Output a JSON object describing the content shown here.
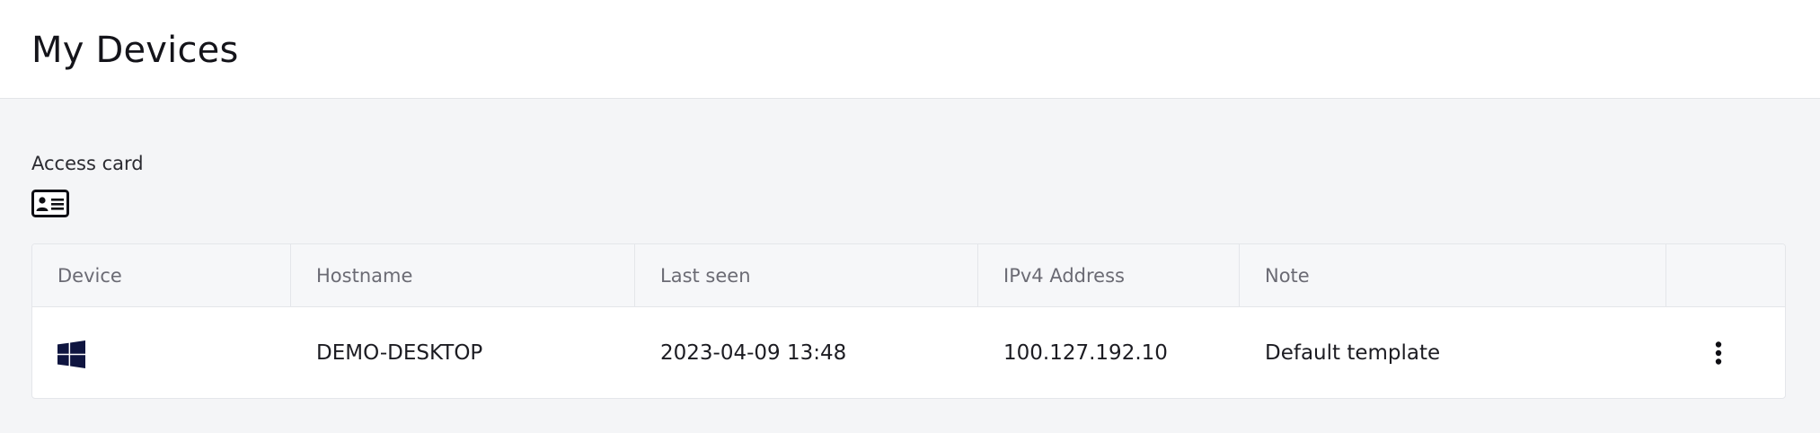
{
  "header": {
    "title": "My Devices"
  },
  "access_card": {
    "label": "Access card",
    "icon": "id-card-icon"
  },
  "table": {
    "columns": [
      "Device",
      "Hostname",
      "Last seen",
      "IPv4 Address",
      "Note",
      ""
    ],
    "rows": [
      {
        "device_icon": "windows-icon",
        "hostname": "DEMO-DESKTOP",
        "last_seen": "2023-04-09 13:48",
        "ipv4": "100.127.192.10",
        "note": "Default template",
        "actions_icon": "kebab-menu-icon"
      }
    ]
  },
  "colors": {
    "page_background": "#f4f5f7",
    "header_background": "#ffffff",
    "border": "#e4e6ea",
    "icon_color": "#0f1540"
  }
}
